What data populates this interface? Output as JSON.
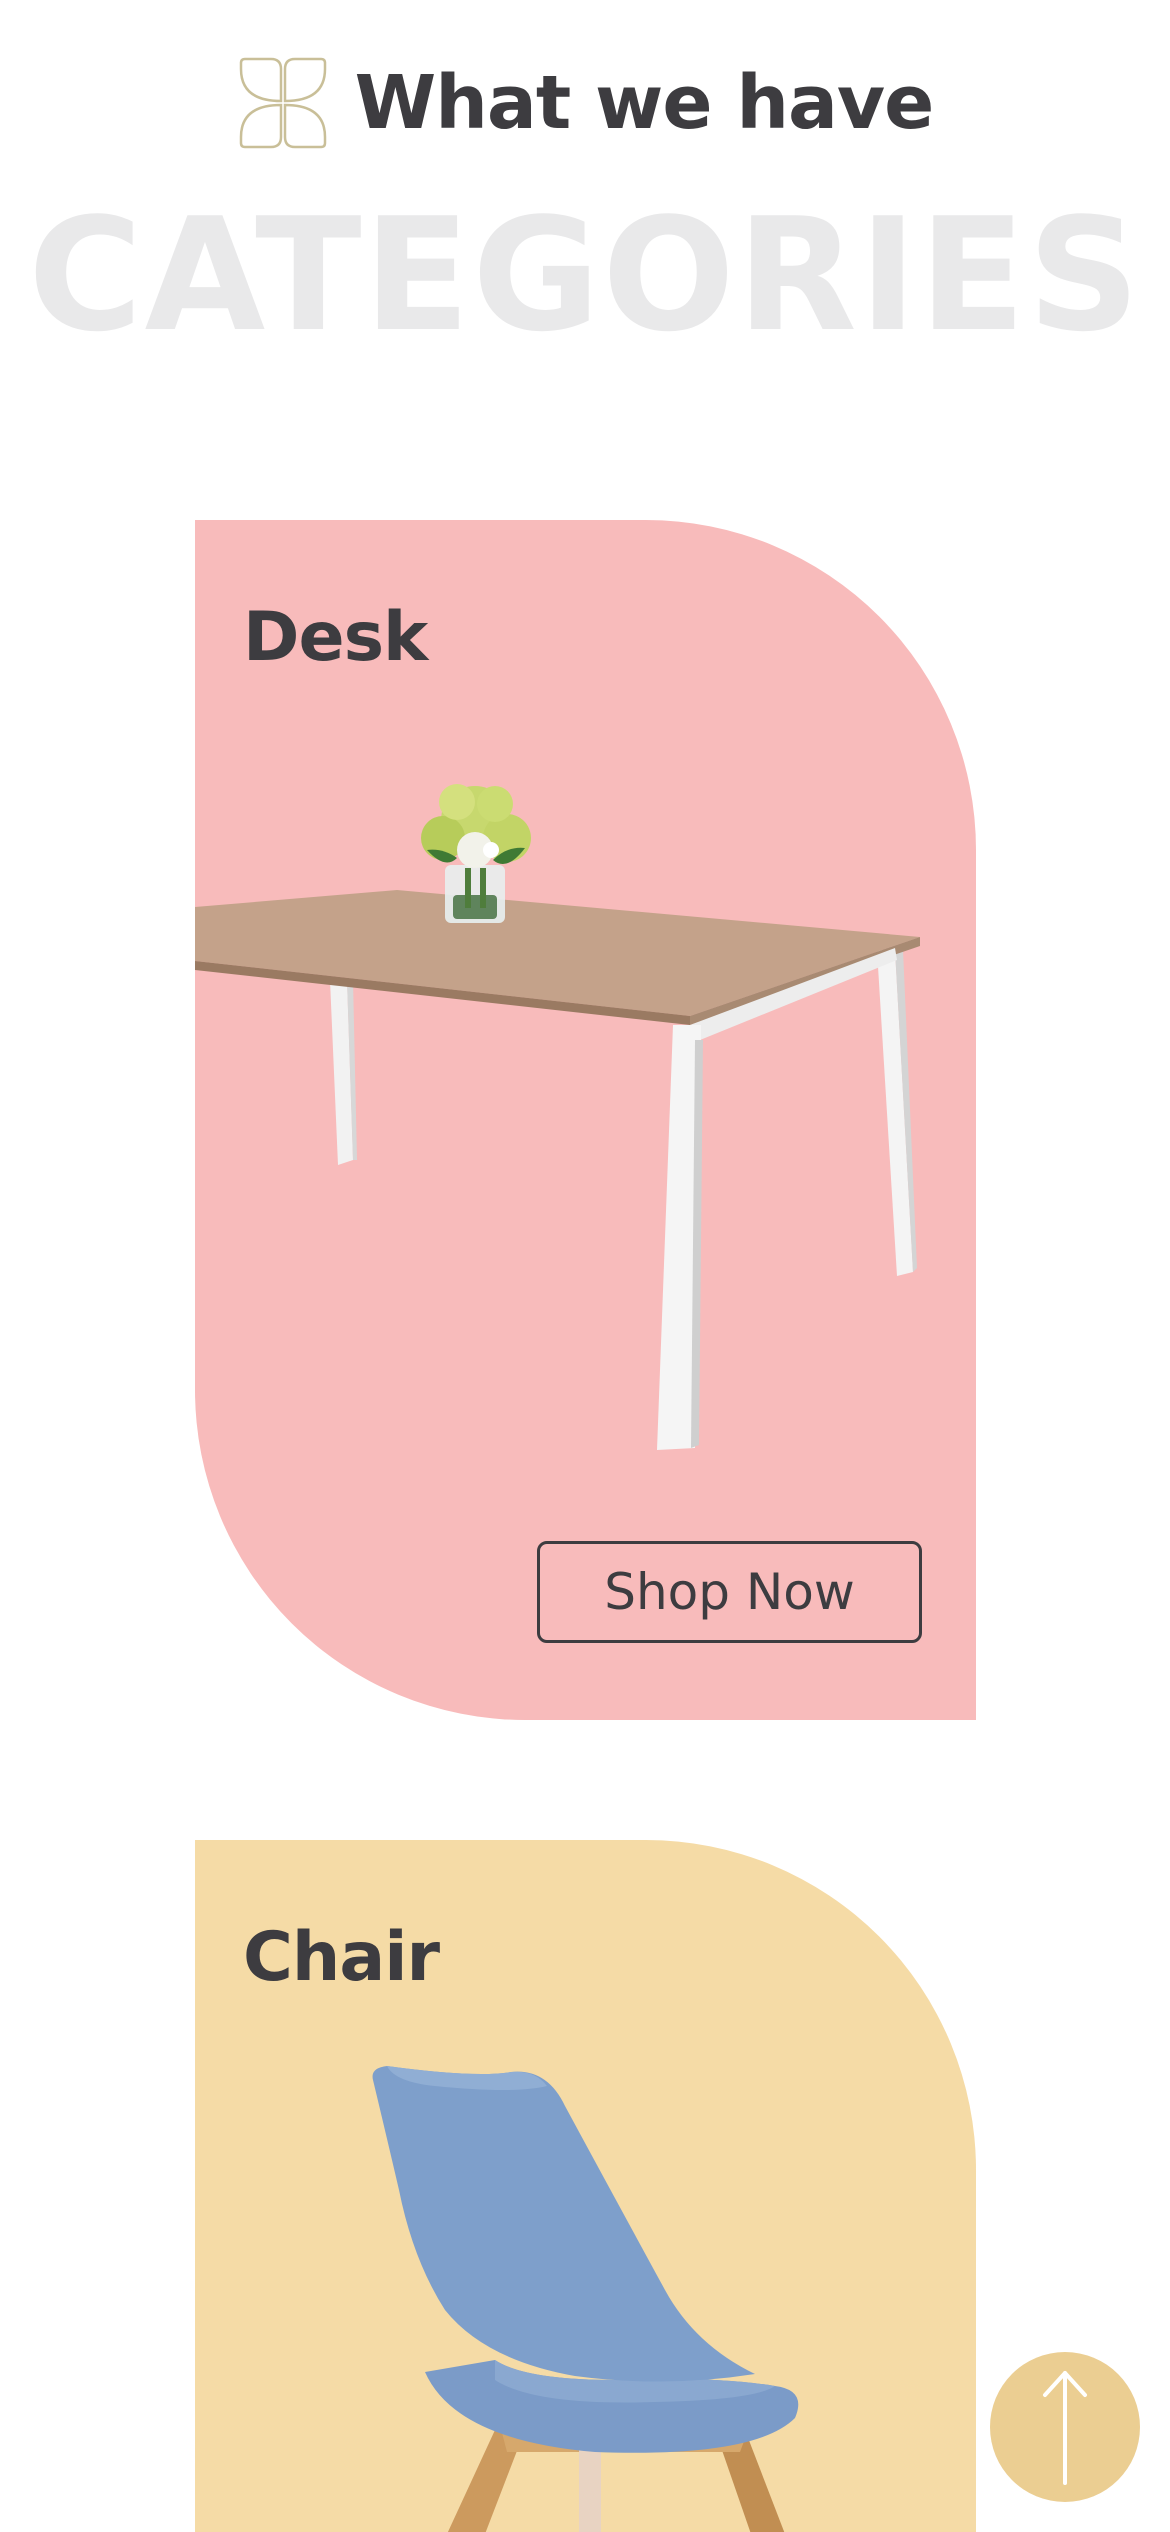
{
  "header": {
    "eyebrow": "What we have",
    "watermark": "CATEGORIES",
    "icon": "flower-icon"
  },
  "categories": [
    {
      "name": "Desk",
      "background": "#f8bbbb",
      "image": "desk-with-flower-vase",
      "cta_label": "Shop Now"
    },
    {
      "name": "Chair",
      "background": "#f5dba6",
      "image": "blue-chair-wooden-legs"
    }
  ],
  "scroll_top": {
    "icon": "arrow-up-icon",
    "color": "#ebce92"
  },
  "colors": {
    "text": "#3d3c40",
    "watermark": "#e9e9ea",
    "icon_gold": "#c9bf98"
  }
}
